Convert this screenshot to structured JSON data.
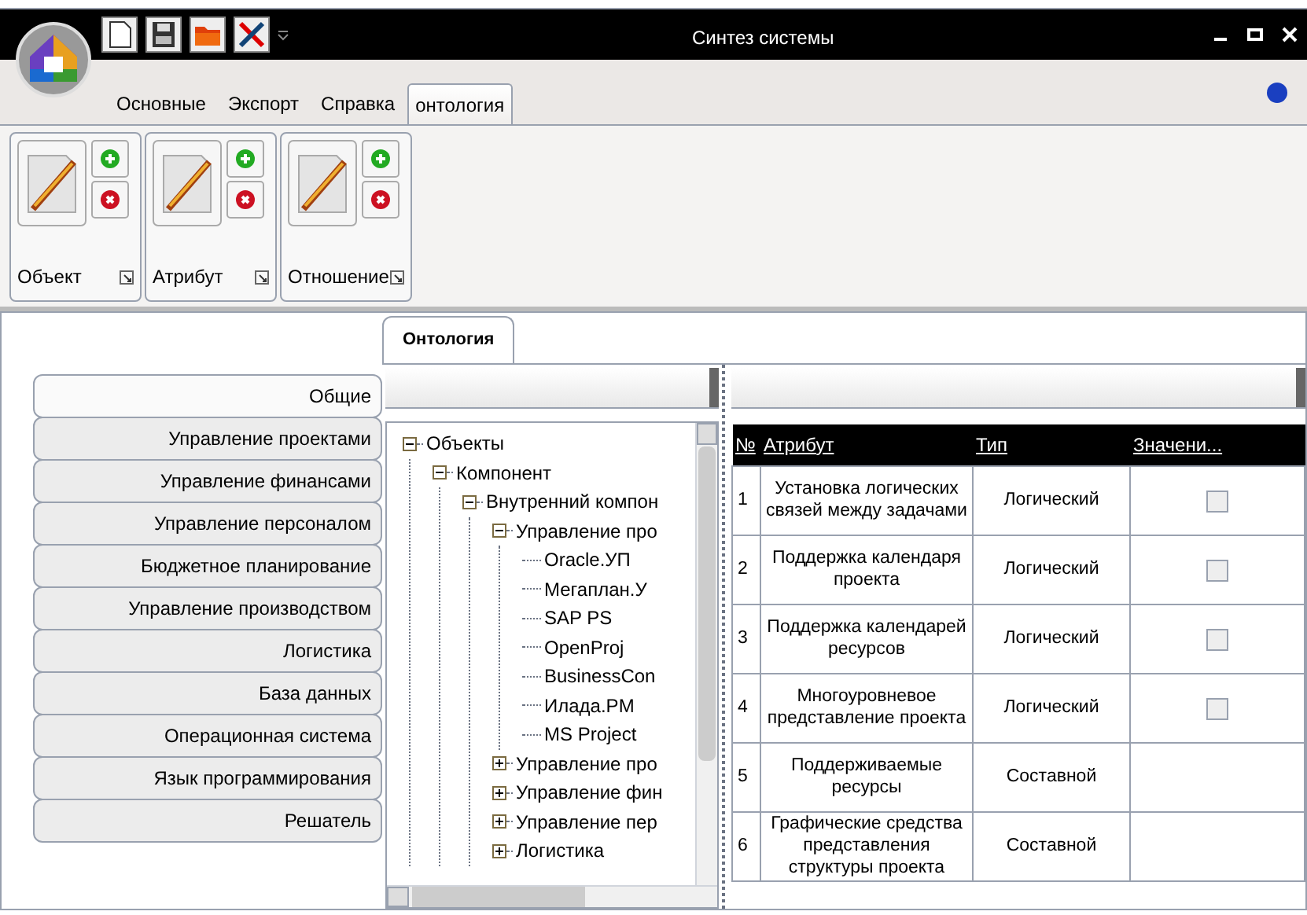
{
  "window": {
    "title": "Синтез системы"
  },
  "ribbon_tabs": [
    {
      "label": "Основные",
      "selected": false
    },
    {
      "label": "Экспорт",
      "selected": false
    },
    {
      "label": "Справка",
      "selected": false
    },
    {
      "label": "онтология",
      "selected": true
    }
  ],
  "ribbon_groups": [
    {
      "label": "Объект"
    },
    {
      "label": "Атрибут"
    },
    {
      "label": "Отношение"
    }
  ],
  "side_tabs": [
    {
      "label": "Общие",
      "selected": true
    },
    {
      "label": "Управление проектами",
      "selected": false
    },
    {
      "label": "Управление финансами",
      "selected": false
    },
    {
      "label": "Управление персоналом",
      "selected": false
    },
    {
      "label": "Бюджетное планирование",
      "selected": false
    },
    {
      "label": "Управление производством",
      "selected": false
    },
    {
      "label": "Логистика",
      "selected": false
    },
    {
      "label": "База данных",
      "selected": false
    },
    {
      "label": "Операционная система",
      "selected": false
    },
    {
      "label": "Язык программирования",
      "selected": false
    },
    {
      "label": "Решатель",
      "selected": false
    }
  ],
  "content_tab": {
    "label": "Онтология"
  },
  "tree": [
    {
      "label": "Объекты",
      "kind": "folder",
      "expanded": true,
      "children": [
        {
          "label": "Компонент",
          "kind": "folder",
          "expanded": true,
          "children": [
            {
              "label": "Внутренний компон",
              "kind": "folder",
              "expanded": true,
              "children": [
                {
                  "label": "Управление про",
                  "kind": "folder",
                  "expanded": true,
                  "children": [
                    {
                      "label": "Oracle.УП",
                      "kind": "leaf"
                    },
                    {
                      "label": "Мегаплан.У",
                      "kind": "leaf"
                    },
                    {
                      "label": "SAP PS",
                      "kind": "leaf"
                    },
                    {
                      "label": "OpenProj",
                      "kind": "leaf"
                    },
                    {
                      "label": "BusinessCon",
                      "kind": "leaf"
                    },
                    {
                      "label": "Илада.PM",
                      "kind": "leaf"
                    },
                    {
                      "label": "MS Project",
                      "kind": "leaf"
                    }
                  ]
                },
                {
                  "label": "Управление про",
                  "kind": "folder",
                  "expanded": false
                },
                {
                  "label": "Управление фин",
                  "kind": "folder",
                  "expanded": false
                },
                {
                  "label": "Управление пер",
                  "kind": "folder",
                  "expanded": false
                },
                {
                  "label": "Логистика",
                  "kind": "folder",
                  "expanded": false
                }
              ]
            }
          ]
        }
      ]
    }
  ],
  "table": {
    "columns": [
      "№",
      "Атрибут",
      "Тип",
      "Значени..."
    ],
    "rows": [
      {
        "n": "1",
        "attribute": "Установка логических связей между задачами",
        "type": "Логический",
        "checked": false
      },
      {
        "n": "2",
        "attribute": "Поддержка календаря проекта",
        "type": "Логический",
        "checked": false
      },
      {
        "n": "3",
        "attribute": "Поддержка календарей ресурсов",
        "type": "Логический",
        "checked": false
      },
      {
        "n": "4",
        "attribute": "Многоуровневое представление проекта",
        "type": "Логический",
        "checked": false
      },
      {
        "n": "5",
        "attribute": "Поддерживаемые ресурсы",
        "type": "Составной"
      },
      {
        "n": "6",
        "attribute": "Графические средства представления структуры проекта",
        "type": "Составной"
      }
    ]
  }
}
